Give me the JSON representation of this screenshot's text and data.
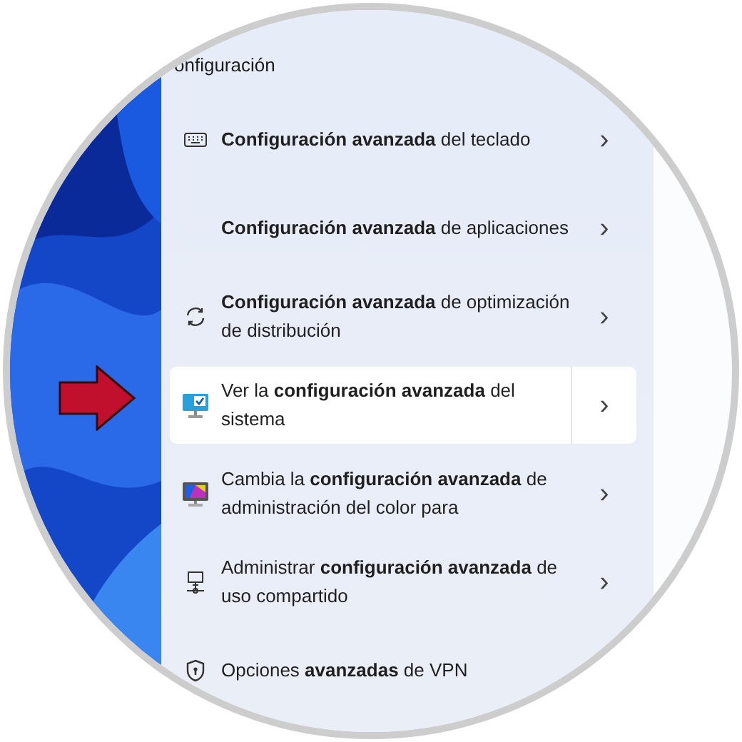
{
  "section": {
    "heading": "onfiguración"
  },
  "results": [
    {
      "text": "**Configuración avanzada** del teclado",
      "selected": false
    },
    {
      "text": "**Configuración avanzada** de aplicaciones",
      "selected": false
    },
    {
      "text": "**Configuración avanzada** de optimización de distribución",
      "selected": false
    },
    {
      "text": "Ver la **configuración avanzada** del sistema",
      "selected": true
    },
    {
      "text": "Cambia la **configuración avanzada** de administración del color para",
      "selected": false
    },
    {
      "text": "Administrar **configuración avanzada** de uso compartido",
      "selected": false
    },
    {
      "text": "Opciones **avanzadas** de VPN",
      "selected": false
    }
  ],
  "chevron": "›"
}
